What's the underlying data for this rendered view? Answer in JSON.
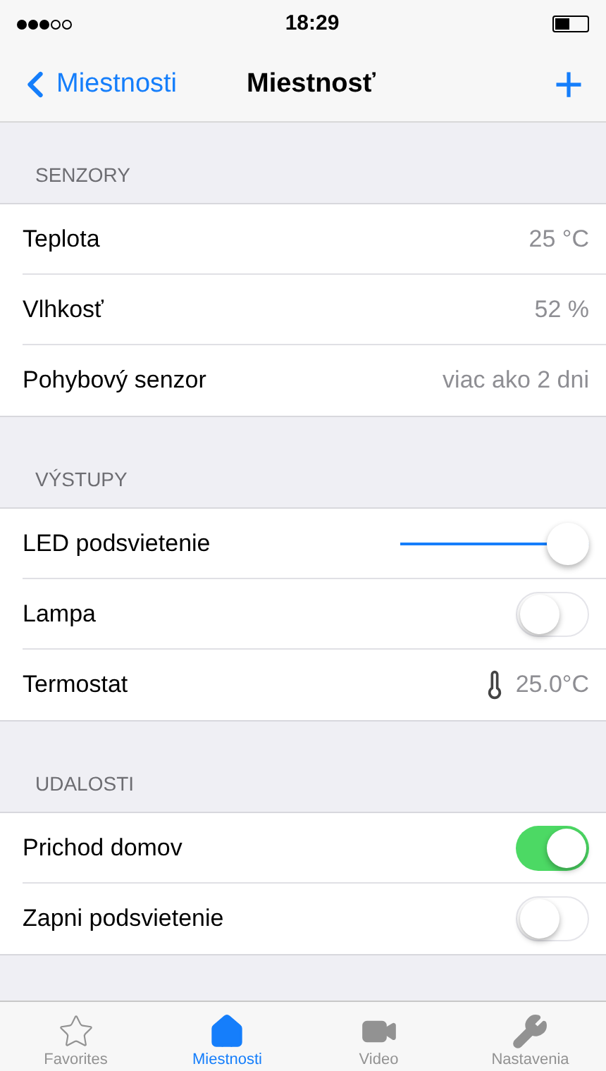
{
  "status_bar": {
    "time": "18:29"
  },
  "nav": {
    "back": "Miestnosti",
    "title": "Miestnosť",
    "add": "+"
  },
  "sections": [
    {
      "header": "SENZORY",
      "rows": [
        {
          "kind": "value",
          "label": "Teplota",
          "value": "25 °C"
        },
        {
          "kind": "value",
          "label": "Vlhkosť",
          "value": "52 %"
        },
        {
          "kind": "value",
          "label": "Pohybový senzor",
          "value": "viac ako 2 dni"
        }
      ]
    },
    {
      "header": "VÝSTUPY",
      "rows": [
        {
          "kind": "slider",
          "label": "LED podsvietenie",
          "level": 1
        },
        {
          "kind": "switch",
          "label": "Lampa",
          "on": false
        },
        {
          "kind": "thermostat",
          "label": "Termostat",
          "value": "25.0°C"
        }
      ]
    },
    {
      "header": "UDALOSTI",
      "rows": [
        {
          "kind": "switch",
          "label": "Prichod domov",
          "on": true
        },
        {
          "kind": "switch",
          "label": "Zapni podsvietenie",
          "on": false
        }
      ]
    }
  ],
  "tab_bar": [
    {
      "kind": "star",
      "label": "Favorites",
      "selected": false
    },
    {
      "kind": "home",
      "label": "Miestnosti",
      "selected": true
    },
    {
      "kind": "video",
      "label": "Video",
      "selected": false
    },
    {
      "kind": "wrench",
      "label": "Nastavenia",
      "selected": false
    }
  ]
}
